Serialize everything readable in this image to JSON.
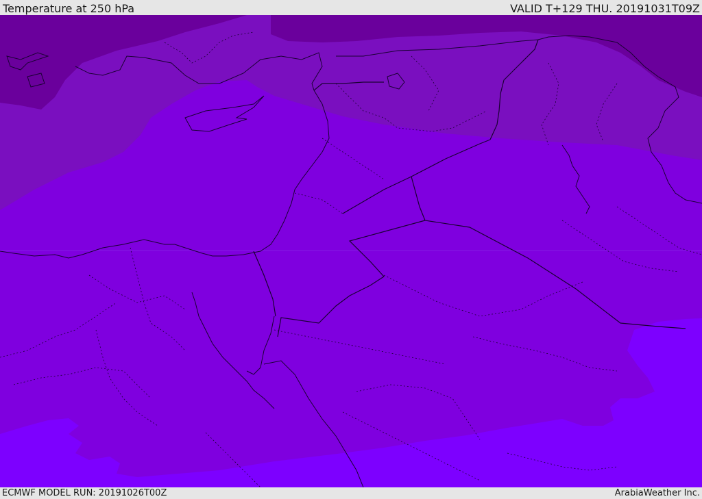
{
  "header": {
    "title": "Temperature at 250 hPa",
    "valid": "VALID T+129 THU. 20191031T09Z"
  },
  "footer": {
    "model_run": "ECMWF MODEL RUN: 20191026T00Z",
    "credit": "ArabiaWeather Inc."
  },
  "map": {
    "colors": {
      "band_coldest": "#6a009c",
      "band_cold": "#7a0fbf",
      "band_mid": "#7d00e0",
      "band_warm": "#7a00d8",
      "band_warmest": "#7d00ff",
      "border_line": "#1a0033"
    }
  }
}
